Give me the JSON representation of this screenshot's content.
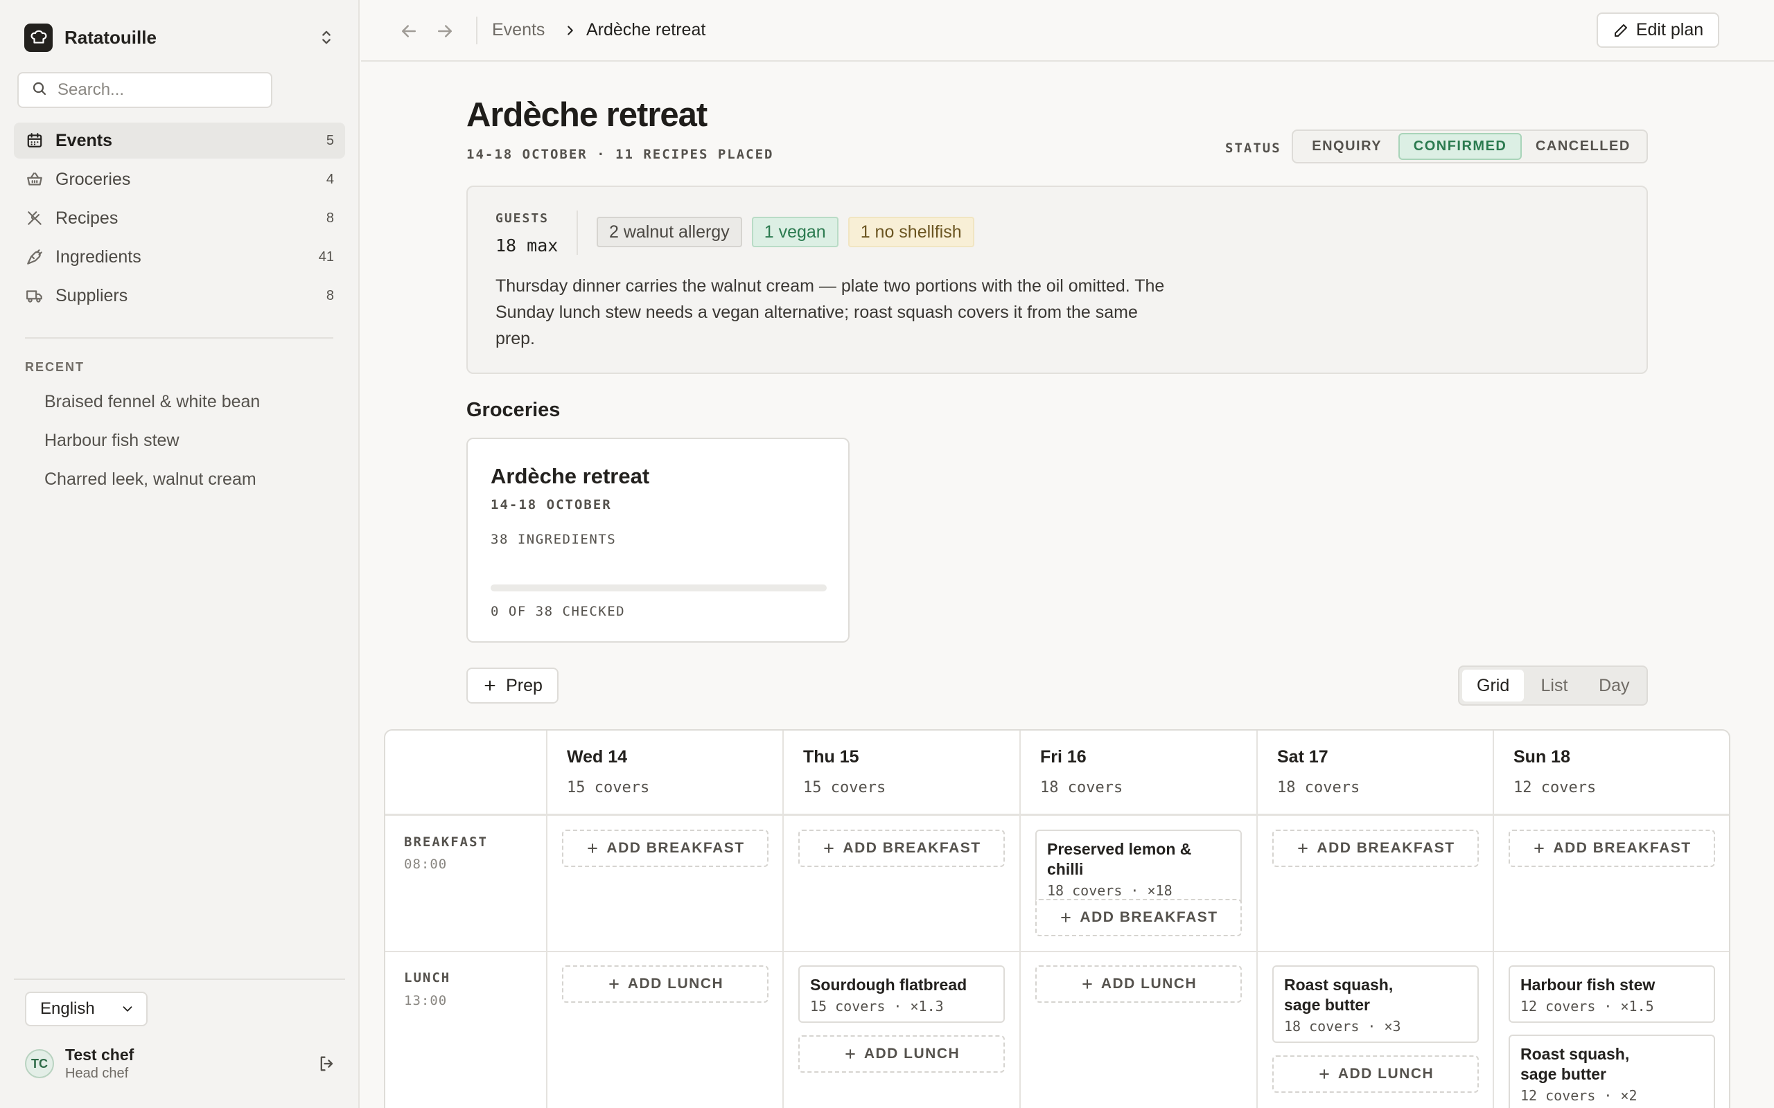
{
  "app": {
    "name": "Ratatouille",
    "search_placeholder": "Search..."
  },
  "sidebar": {
    "nav": [
      {
        "label": "Events",
        "count": "5",
        "icon": "calendar-icon",
        "active": true
      },
      {
        "label": "Groceries",
        "count": "4",
        "icon": "basket-icon"
      },
      {
        "label": "Recipes",
        "count": "8",
        "icon": "utensils-icon"
      },
      {
        "label": "Ingredients",
        "count": "41",
        "icon": "carrot-icon"
      },
      {
        "label": "Suppliers",
        "count": "8",
        "icon": "truck-icon"
      }
    ],
    "recent_title": "RECENT",
    "recent": [
      "Braised fennel & white bean",
      "Harbour fish stew",
      "Charred leek, walnut cream"
    ],
    "language": "English",
    "user": {
      "initials": "TC",
      "name": "Test chef",
      "role": "Head chef"
    }
  },
  "topbar": {
    "breadcrumb": [
      "Events",
      "Ardèche retreat"
    ],
    "edit_label": "Edit plan"
  },
  "event": {
    "title": "Ardèche retreat",
    "subtitle": "14-18 OCTOBER · 11 RECIPES PLACED",
    "status_label": "STATUS",
    "status_options": [
      "ENQUIRY",
      "CONFIRMED",
      "CANCELLED"
    ],
    "status_selected": "CONFIRMED",
    "guests_label": "GUESTS",
    "guests_value": "18 max",
    "tags": [
      "2 walnut allergy",
      "1 vegan",
      "1 no shellfish"
    ],
    "note": "Thursday dinner carries the walnut cream — plate two portions with the oil omitted. The Sunday lunch stew needs a vegan alternative; roast squash covers it from the same prep."
  },
  "groceries": {
    "section_title": "Groceries",
    "card": {
      "title": "Ardèche retreat",
      "date": "14-18 OCTOBER",
      "ingredients": "38 INGREDIENTS",
      "checked": "0 OF 38 CHECKED",
      "progress": 0
    }
  },
  "controls": {
    "prep_label": "Prep",
    "views": [
      "Grid",
      "List",
      "Day"
    ],
    "view_selected": "Grid"
  },
  "plan": {
    "days": [
      {
        "name": "Wed 14",
        "covers": "15 covers"
      },
      {
        "name": "Thu 15",
        "covers": "15 covers"
      },
      {
        "name": "Fri 16",
        "covers": "18 covers"
      },
      {
        "name": "Sat 17",
        "covers": "18 covers"
      },
      {
        "name": "Sun 18",
        "covers": "12 covers"
      }
    ],
    "meals": [
      {
        "name": "BREAKFAST",
        "time": "08:00",
        "add_label": "ADD BREAKFAST"
      },
      {
        "name": "LUNCH",
        "time": "13:00",
        "add_label": "ADD LUNCH"
      }
    ],
    "recipes": {
      "fri_breakfast": {
        "name": "Preserved lemon & chilli",
        "meta": "18 covers · ×18"
      },
      "thu_lunch": {
        "name": "Sourdough flatbread",
        "meta": "15 covers · ×1.3"
      },
      "sat_lunch": {
        "name": "Roast squash, sage butter",
        "meta": "18 covers · ×3"
      },
      "sun_lunch_1": {
        "name": "Harbour fish stew",
        "meta": "12 covers · ×1.5"
      },
      "sun_lunch_2": {
        "name": "Roast squash, sage butter",
        "meta": "12 covers · ×2"
      }
    }
  },
  "colors": {
    "accent": "#2b7a4f",
    "background": "#f9f8f6",
    "sidebar": "#f4f3f1"
  }
}
